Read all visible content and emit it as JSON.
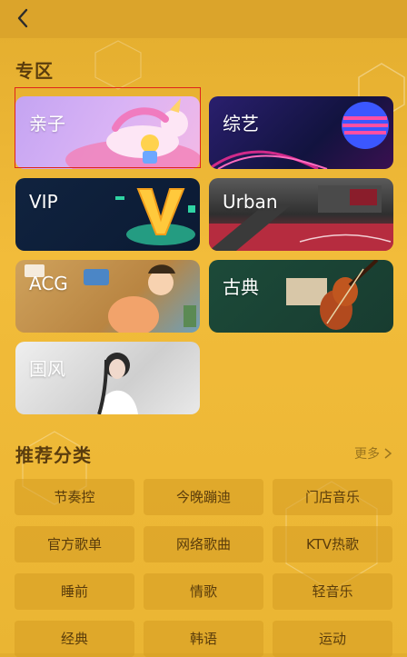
{
  "header": {
    "back_icon": "chevron-left-icon"
  },
  "zone": {
    "title": "专区",
    "cards": [
      {
        "label": "亲子",
        "theme": "unicorn-illustration",
        "color": "#c9a6f0"
      },
      {
        "label": "综艺",
        "theme": "striped-planet",
        "color": "#1e1a5a"
      },
      {
        "label": "VIP",
        "theme": "golden-v-trophy",
        "color": "#0f1f3a"
      },
      {
        "label": "Urban",
        "theme": "street-stairs",
        "color": "#b5283a"
      },
      {
        "label": "ACG",
        "theme": "anime-illustration",
        "color": "#d3a45a"
      },
      {
        "label": "古典",
        "theme": "violin",
        "color": "#1c4637"
      },
      {
        "label": "国风",
        "theme": "hanfu-portrait",
        "color": "#d9d9d9"
      }
    ]
  },
  "recommend": {
    "title": "推荐分类",
    "more_label": "更多",
    "more_icon": "chevron-right-icon",
    "tags": [
      "节奏控",
      "今晚蹦迪",
      "门店音乐",
      "官方歌单",
      "网络歌曲",
      "KTV热歌",
      "睡前",
      "情歌",
      "轻音乐",
      "经典",
      "韩语",
      "运动"
    ]
  },
  "colors": {
    "background": "#eeb735",
    "header": "#dba42b",
    "tag_bg": "#d9a02b",
    "selection": "#e0231b"
  }
}
